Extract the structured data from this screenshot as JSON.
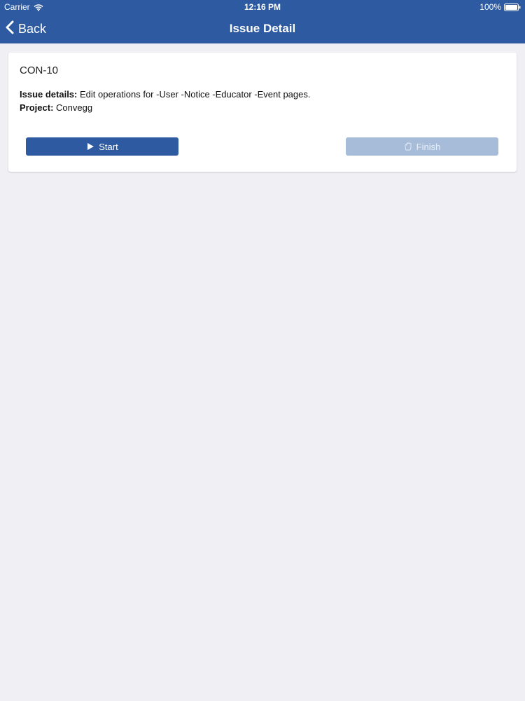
{
  "status_bar": {
    "carrier": "Carrier",
    "time": "12:16 PM",
    "battery": "100%"
  },
  "nav": {
    "back_label": "Back",
    "title": "Issue Detail"
  },
  "issue": {
    "key": "CON-10",
    "details_label": "Issue details:",
    "details_value": "Edit operations for -User -Notice -Educator -Event  pages.",
    "project_label": "Project:",
    "project_value": "Convegg"
  },
  "actions": {
    "start_label": "Start",
    "finish_label": "Finish"
  },
  "icons": {
    "back": "chevron-left-icon",
    "start": "play-icon",
    "finish": "hand-icon",
    "wifi": "wifi-icon",
    "battery": "battery-icon"
  },
  "colors": {
    "nav_background": "#2d5aa0",
    "page_background": "#efeff4",
    "start_button": "#2d5aa0",
    "finish_button_disabled": "#a7bcd9"
  }
}
